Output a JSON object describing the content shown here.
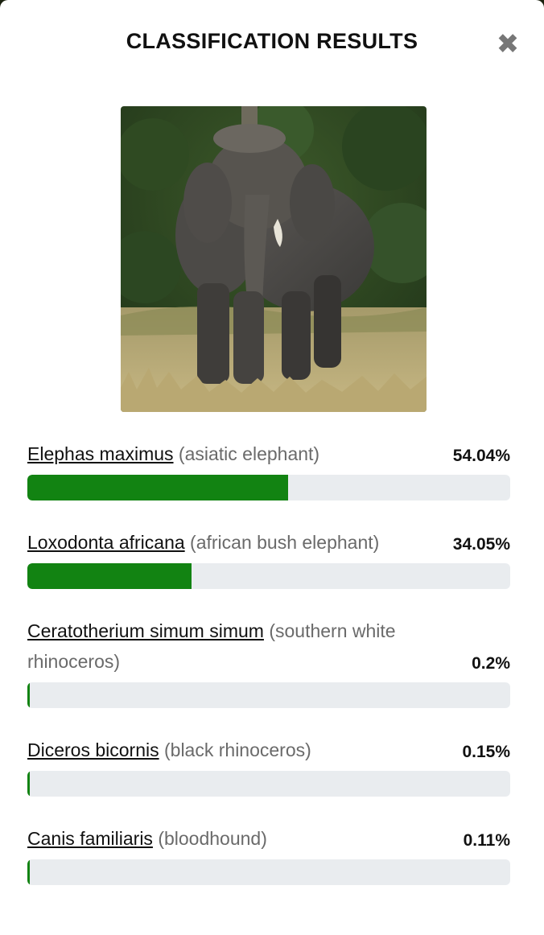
{
  "modal": {
    "title": "CLASSIFICATION RESULTS",
    "close_icon": "close-icon"
  },
  "image": {
    "subject": "elephant-photo"
  },
  "accent_color": "#128312",
  "track_color": "#e9ecef",
  "results": [
    {
      "scientific": "Elephas maximus",
      "common": "(asiatic elephant)",
      "percent": "54.04%",
      "fraction": 0.5404
    },
    {
      "scientific": "Loxodonta africana",
      "common": "(african bush elephant)",
      "percent": "34.05%",
      "fraction": 0.3405
    },
    {
      "scientific": "Ceratotherium simum simum",
      "common": "(southern white rhinoceros)",
      "percent": "0.2%",
      "fraction": 0.002
    },
    {
      "scientific": "Diceros bicornis",
      "common": "(black rhinoceros)",
      "percent": "0.15%",
      "fraction": 0.0015
    },
    {
      "scientific": "Canis familiaris",
      "common": "(bloodhound)",
      "percent": "0.11%",
      "fraction": 0.0011
    }
  ]
}
